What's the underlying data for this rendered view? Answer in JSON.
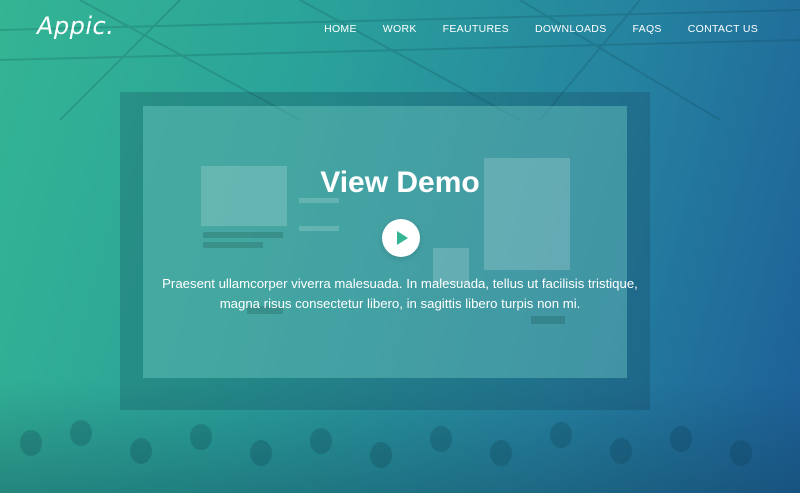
{
  "brand": {
    "logo_text": "Appic."
  },
  "nav": {
    "items": [
      {
        "label": "HOME"
      },
      {
        "label": "WORK"
      },
      {
        "label": "FEAUTURES"
      },
      {
        "label": "DOWNLOADS"
      },
      {
        "label": "FAQS"
      },
      {
        "label": "CONTACT US"
      }
    ]
  },
  "hero": {
    "title": "View Demo",
    "description": "Praesent ullamcorper viverra malesuada. In malesuada, tellus ut facilisis tristique, magna risus consectetur libero, in sagittis libero turpis non mi.",
    "play_icon": "play-icon"
  },
  "colors": {
    "gradient_start": "#34b593",
    "gradient_end": "#1d5f98",
    "play_accent": "#34b593",
    "text": "#ffffff"
  }
}
